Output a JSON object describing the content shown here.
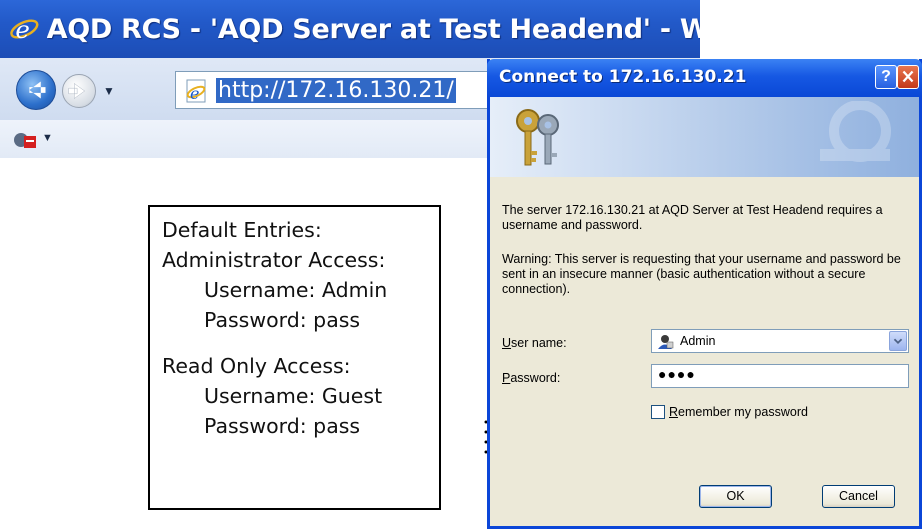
{
  "browser": {
    "window_title": "AQD RCS - 'AQD Server at Test Headend' - Windows Ir",
    "address": "http://172.16.130.21/",
    "icons": [
      "ie-logo-icon",
      "back-arrow-icon",
      "forward-arrow-icon",
      "page-icon",
      "rss-feed-icon"
    ]
  },
  "note": {
    "title": "Default Entries:",
    "admin_heading": "Administrator Access:",
    "admin_username": "Username: Admin",
    "admin_password": "Password: pass",
    "readonly_heading": "Read Only Access:",
    "readonly_username": "Username: Guest",
    "readonly_password": "Password: pass"
  },
  "dialog": {
    "title": "Connect to 172.16.130.21",
    "help_label": "?",
    "message1": "The server 172.16.130.21 at AQD Server at Test Headend requires a username and password.",
    "message2": "Warning: This server is requesting that your username and password be sent in an insecure manner (basic authentication without a secure connection).",
    "user_label_u": "U",
    "user_label_rest": "ser name:",
    "user_value": "Admin",
    "pass_label_u": "P",
    "pass_label_rest": "assword:",
    "pass_value": "●●●●",
    "remember_u": "R",
    "remember_rest": "emember my password",
    "remember_checked": false,
    "ok_label": "OK",
    "cancel_label": "Cancel",
    "colors": {
      "titlebar": "#1658e3",
      "body": "#ece9d8",
      "close": "#c3391a"
    }
  }
}
